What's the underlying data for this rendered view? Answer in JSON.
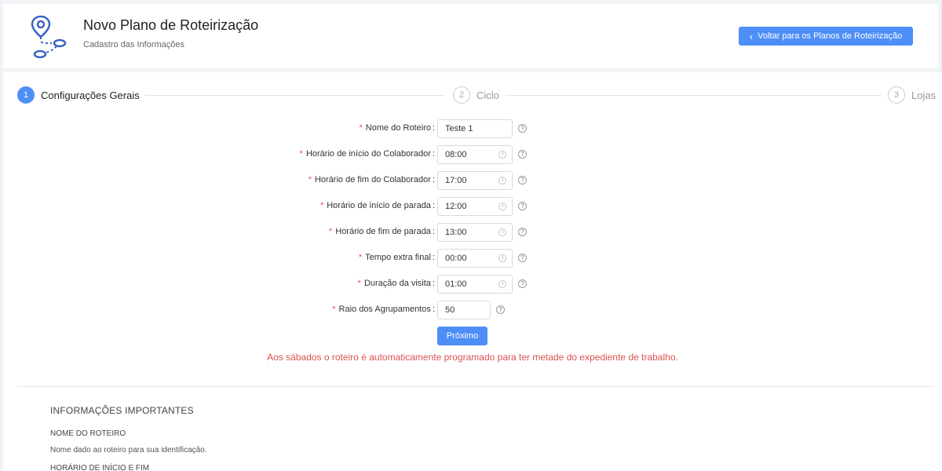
{
  "header": {
    "title": "Novo Plano de Roteirização",
    "subtitle": "Cadastro das Informações",
    "back_label": "Voltar para os Planos de Roteirização",
    "logo_icon": "route-map-icon"
  },
  "steps": [
    {
      "number": "1",
      "label": "Configurações Gerais",
      "state": "active"
    },
    {
      "number": "2",
      "label": "Ciclo",
      "state": "inactive"
    },
    {
      "number": "3",
      "label": "Lojas",
      "state": "inactive"
    }
  ],
  "form": {
    "fields": [
      {
        "label": "Nome do Roteiro",
        "value": "Teste 1",
        "type": "text"
      },
      {
        "label": "Horário de início do Colaborador",
        "value": "08:00",
        "type": "time"
      },
      {
        "label": "Horário de fim do Colaborador",
        "value": "17:00",
        "type": "time"
      },
      {
        "label": "Horário de início de parada",
        "value": "12:00",
        "type": "time"
      },
      {
        "label": "Horário de fim de parada",
        "value": "13:00",
        "type": "time"
      },
      {
        "label": "Tempo extra final",
        "value": "00:00",
        "type": "time"
      },
      {
        "label": "Duração da visita",
        "value": "01:00",
        "type": "time"
      },
      {
        "label": "Raio dos Agrupamentos",
        "value": "50",
        "type": "number"
      }
    ],
    "required_mark": "*",
    "next_label": "Próximo",
    "warning": "Aos sábados o roteiro é automaticamente programado para ter metade do expediente de trabalho."
  },
  "info": {
    "title": "INFORMAÇÕES IMPORTANTES",
    "sections": [
      {
        "heading": "NOME DO ROTEIRO",
        "text": "Nome dado ao roteiro para sua identificação."
      },
      {
        "heading": "HORÁRIO DE INÍCIO E FIM",
        "text": ""
      }
    ]
  },
  "colors": {
    "primary": "#4e8ef7",
    "required": "#e05555",
    "warning": "#d9534f"
  }
}
